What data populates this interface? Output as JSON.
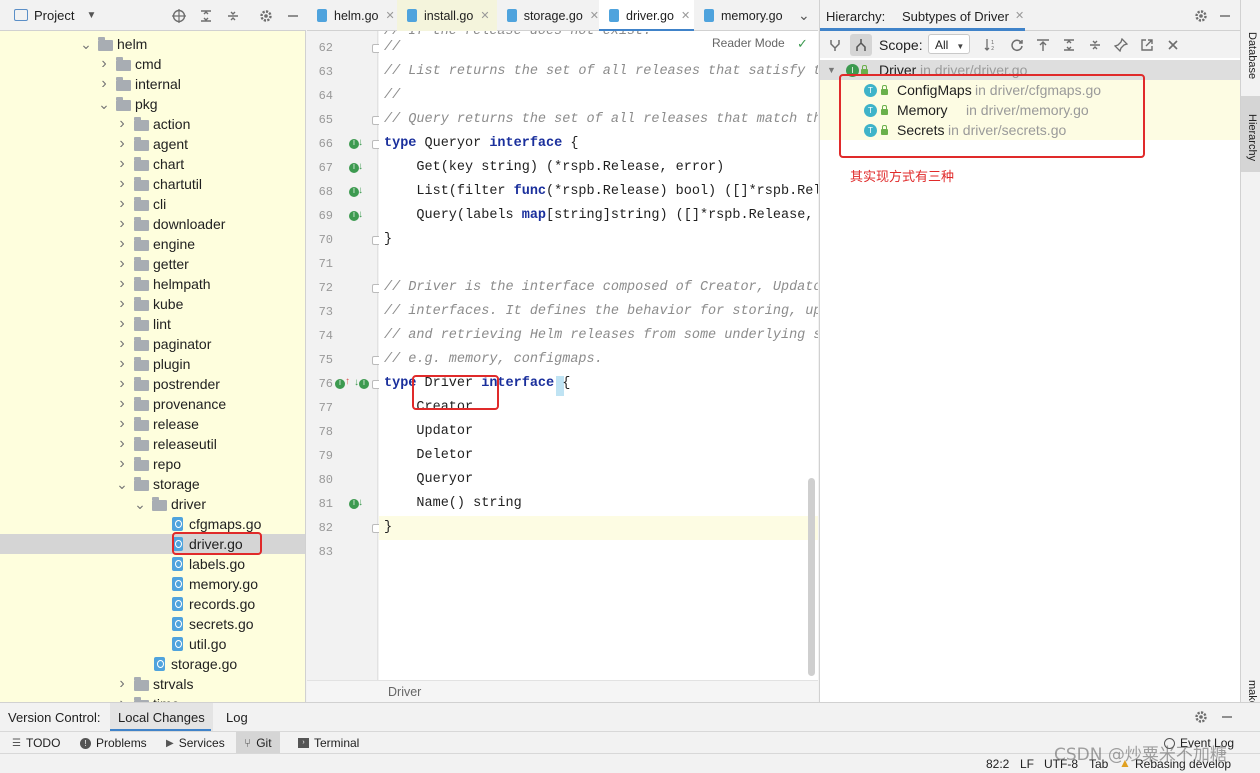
{
  "project_panel": {
    "title": "Project",
    "tree": [
      {
        "label": "helm",
        "kind": "folder",
        "depth": 0,
        "expanded": true
      },
      {
        "label": "cmd",
        "kind": "folder",
        "depth": 1,
        "expanded": false
      },
      {
        "label": "internal",
        "kind": "folder",
        "depth": 1,
        "expanded": false
      },
      {
        "label": "pkg",
        "kind": "folder",
        "depth": 1,
        "expanded": true
      },
      {
        "label": "action",
        "kind": "folder",
        "depth": 2,
        "expanded": false
      },
      {
        "label": "agent",
        "kind": "folder",
        "depth": 2,
        "expanded": false
      },
      {
        "label": "chart",
        "kind": "folder",
        "depth": 2,
        "expanded": false
      },
      {
        "label": "chartutil",
        "kind": "folder",
        "depth": 2,
        "expanded": false
      },
      {
        "label": "cli",
        "kind": "folder",
        "depth": 2,
        "expanded": false
      },
      {
        "label": "downloader",
        "kind": "folder",
        "depth": 2,
        "expanded": false
      },
      {
        "label": "engine",
        "kind": "folder",
        "depth": 2,
        "expanded": false
      },
      {
        "label": "getter",
        "kind": "folder",
        "depth": 2,
        "expanded": false
      },
      {
        "label": "helmpath",
        "kind": "folder",
        "depth": 2,
        "expanded": false
      },
      {
        "label": "kube",
        "kind": "folder",
        "depth": 2,
        "expanded": false
      },
      {
        "label": "lint",
        "kind": "folder",
        "depth": 2,
        "expanded": false
      },
      {
        "label": "paginator",
        "kind": "folder",
        "depth": 2,
        "expanded": false
      },
      {
        "label": "plugin",
        "kind": "folder",
        "depth": 2,
        "expanded": false
      },
      {
        "label": "postrender",
        "kind": "folder",
        "depth": 2,
        "expanded": false
      },
      {
        "label": "provenance",
        "kind": "folder",
        "depth": 2,
        "expanded": false
      },
      {
        "label": "release",
        "kind": "folder",
        "depth": 2,
        "expanded": false
      },
      {
        "label": "releaseutil",
        "kind": "folder",
        "depth": 2,
        "expanded": false
      },
      {
        "label": "repo",
        "kind": "folder",
        "depth": 2,
        "expanded": false
      },
      {
        "label": "storage",
        "kind": "folder",
        "depth": 2,
        "expanded": true
      },
      {
        "label": "driver",
        "kind": "folder",
        "depth": 3,
        "expanded": true
      },
      {
        "label": "cfgmaps.go",
        "kind": "file",
        "depth": 4
      },
      {
        "label": "driver.go",
        "kind": "file",
        "depth": 4,
        "selected": true
      },
      {
        "label": "labels.go",
        "kind": "file",
        "depth": 4
      },
      {
        "label": "memory.go",
        "kind": "file",
        "depth": 4
      },
      {
        "label": "records.go",
        "kind": "file",
        "depth": 4
      },
      {
        "label": "secrets.go",
        "kind": "file",
        "depth": 4
      },
      {
        "label": "util.go",
        "kind": "file",
        "depth": 4
      },
      {
        "label": "storage.go",
        "kind": "file",
        "depth": 3
      },
      {
        "label": "strvals",
        "kind": "folder",
        "depth": 2,
        "expanded": false
      },
      {
        "label": "time",
        "kind": "folder",
        "depth": 2,
        "expanded": false
      }
    ]
  },
  "editor": {
    "tabs": [
      {
        "label": "helm.go",
        "active": false
      },
      {
        "label": "install.go",
        "active": false
      },
      {
        "label": "storage.go",
        "active": false
      },
      {
        "label": "driver.go",
        "active": true
      },
      {
        "label": "memory.go",
        "active": false
      }
    ],
    "reader_mode": "Reader Mode",
    "breadcrumb": "Driver",
    "lines": [
      {
        "n": "62",
        "text": "//"
      },
      {
        "n": "63",
        "text": "// List returns the set of all releases that satisfy the"
      },
      {
        "n": "64",
        "text": "//"
      },
      {
        "n": "65",
        "text": "// Query returns the set of all releases that match the"
      },
      {
        "n": "66",
        "text": "type Queryor interface {"
      },
      {
        "n": "67",
        "text": "    Get(key string) (*rspb.Release, error)"
      },
      {
        "n": "68",
        "text": "    List(filter func(*rspb.Release) bool) ([]*rspb.Relea"
      },
      {
        "n": "69",
        "text": "    Query(labels map[string]string) ([]*rspb.Release, er"
      },
      {
        "n": "70",
        "text": "}"
      },
      {
        "n": "71",
        "text": ""
      },
      {
        "n": "72",
        "text": "// Driver is the interface composed of Creator, Updator,"
      },
      {
        "n": "73",
        "text": "// interfaces. It defines the behavior for storing, upda"
      },
      {
        "n": "74",
        "text": "// and retrieving Helm releases from some underlying sto"
      },
      {
        "n": "75",
        "text": "// e.g. memory, configmaps."
      },
      {
        "n": "76",
        "text": "type Driver interface {"
      },
      {
        "n": "77",
        "text": "    Creator"
      },
      {
        "n": "78",
        "text": "    Updator"
      },
      {
        "n": "79",
        "text": "    Deletor"
      },
      {
        "n": "80",
        "text": "    Queryor"
      },
      {
        "n": "81",
        "text": "    Name() string"
      },
      {
        "n": "82",
        "text": "}"
      },
      {
        "n": "83",
        "text": ""
      }
    ]
  },
  "hierarchy": {
    "label": "Hierarchy:",
    "tab": "Subtypes of Driver",
    "scope_label": "Scope:",
    "scope_value": "All",
    "root": {
      "name": "Driver",
      "location": "in driver/driver.go"
    },
    "children": [
      {
        "name": "ConfigMaps",
        "location": "in driver/cfgmaps.go"
      },
      {
        "name": "Memory",
        "location": "in driver/memory.go"
      },
      {
        "name": "Secrets",
        "location": "in driver/secrets.go"
      }
    ],
    "annotation": "其实现方式有三种"
  },
  "right_strip": {
    "database": "Database",
    "hierarchy": "Hierarchy",
    "make": "make"
  },
  "version_control": {
    "label": "Version Control:",
    "tabs": [
      "Local Changes",
      "Log"
    ]
  },
  "tool_windows": [
    "TODO",
    "Problems",
    "Services",
    "Git",
    "Terminal",
    "Event Log"
  ],
  "status": {
    "position": "82:2",
    "line_sep": "LF",
    "encoding": "UTF-8",
    "indent": "Tab",
    "vcs": "Rebasing develop",
    "watermark": "CSDN @炒粟米不加糖"
  },
  "colors": {
    "keyword": "#1a2f9c",
    "comment": "#8c8c8c",
    "selection": "#d5d5d5",
    "tree_bg": "#fefedd",
    "annotation": "#e02a2a"
  }
}
